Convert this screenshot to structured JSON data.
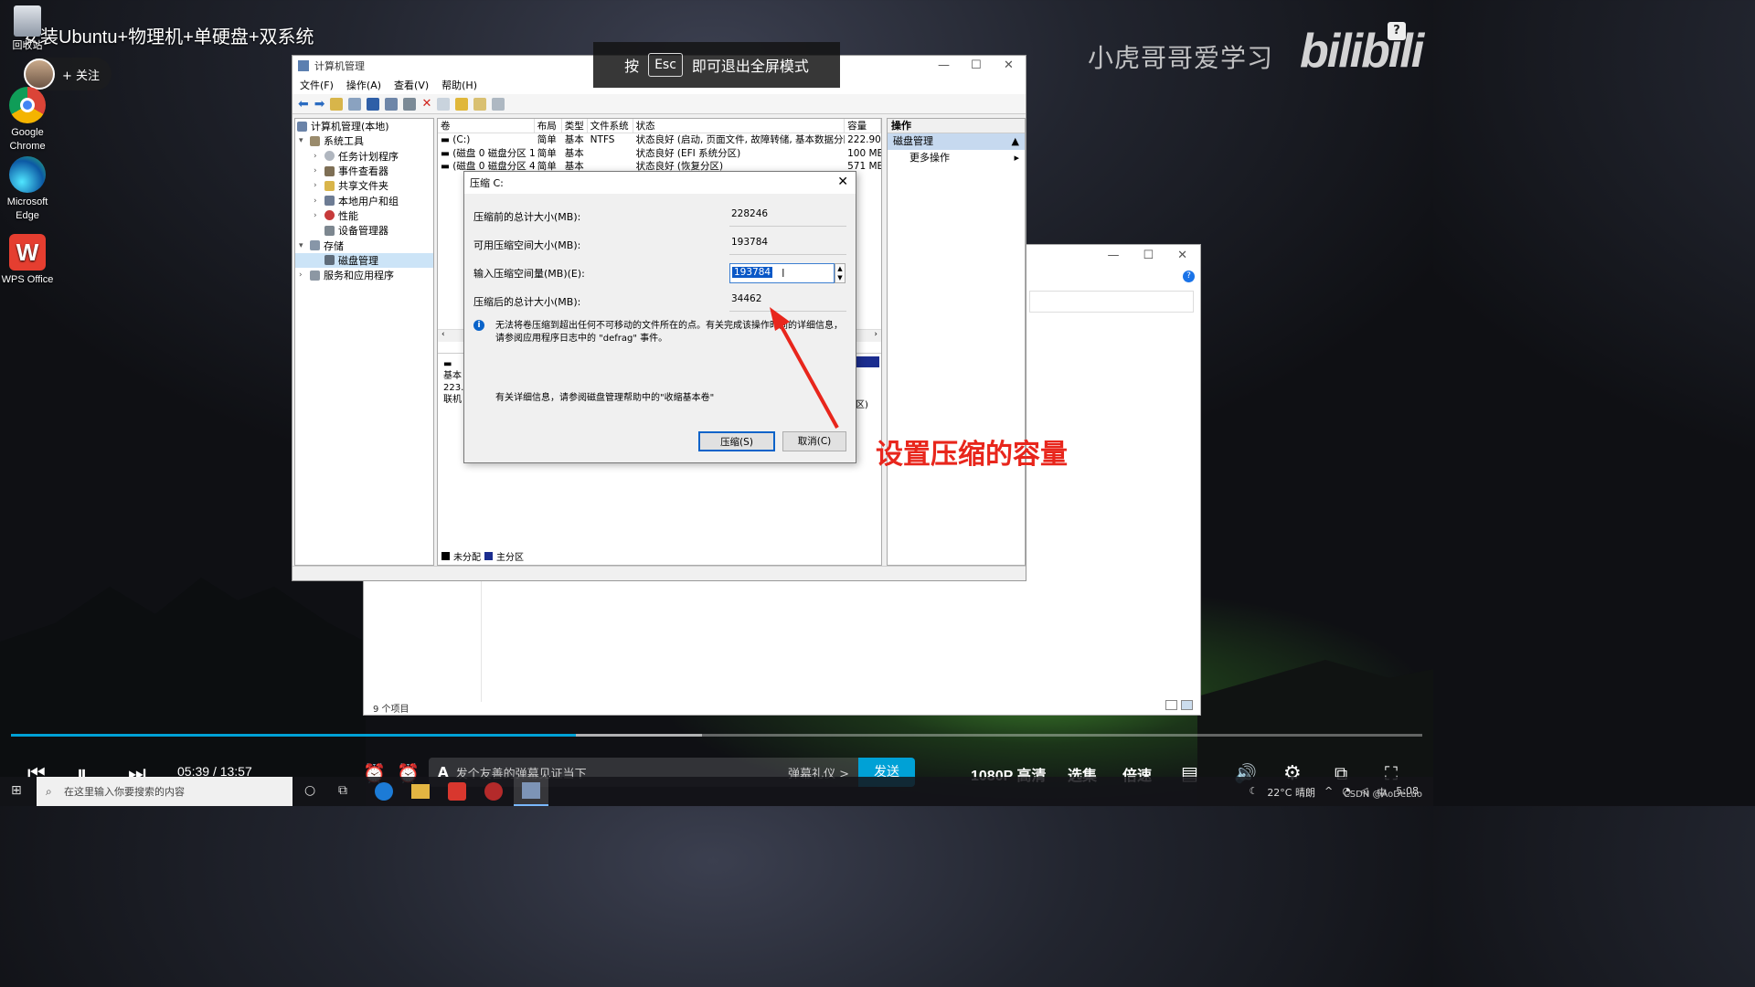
{
  "video": {
    "title": "安装Ubuntu+物理机+单硬盘+双系统",
    "follow_label": "+ 关注",
    "watermark": "小虎哥哥爱学习",
    "logo": "bilibili",
    "esc_prefix": "按",
    "esc_key": "Esc",
    "esc_suffix": "即可退出全屏模式",
    "annotation": "设置压缩的容量"
  },
  "desktop": {
    "icons": [
      {
        "label": "回收站",
        "icon": "recycle-bin-icon"
      },
      {
        "label": "Google Chrome",
        "icon": "chrome-icon"
      },
      {
        "label": "Microsoft Edge",
        "icon": "edge-icon"
      },
      {
        "label": "WPS Office",
        "icon": "wps-office-icon"
      }
    ]
  },
  "mmc": {
    "title": "计算机管理",
    "menus": [
      "文件(F)",
      "操作(A)",
      "查看(V)",
      "帮助(H)"
    ],
    "tree": [
      {
        "label": "计算机管理(本地)"
      },
      {
        "label": "系统工具"
      },
      {
        "label": "任务计划程序"
      },
      {
        "label": "事件查看器"
      },
      {
        "label": "共享文件夹"
      },
      {
        "label": "本地用户和组"
      },
      {
        "label": "性能"
      },
      {
        "label": "设备管理器"
      },
      {
        "label": "存储"
      },
      {
        "label": "磁盘管理"
      },
      {
        "label": "服务和应用程序"
      }
    ],
    "columns": [
      "卷",
      "布局",
      "类型",
      "文件系统",
      "状态",
      "容量"
    ],
    "volumes": [
      {
        "vol": "(C:)",
        "layout": "简单",
        "type": "基本",
        "fs": "NTFS",
        "status": "状态良好 (启动, 页面文件, 故障转储, 基本数据分区)",
        "cap": "222.90"
      },
      {
        "vol": "(磁盘 0 磁盘分区 1)",
        "layout": "简单",
        "type": "基本",
        "fs": "",
        "status": "状态良好 (EFI 系统分区)",
        "cap": "100 MB"
      },
      {
        "vol": "(磁盘 0 磁盘分区 4)",
        "layout": "简单",
        "type": "基本",
        "fs": "",
        "status": "状态良好 (恢复分区)",
        "cap": "571 MB"
      }
    ],
    "disk_info": [
      "基本",
      "223.",
      "联机"
    ],
    "disk_part_suffix": "区)",
    "legend": {
      "unallocated": "未分配",
      "primary": "主分区"
    },
    "actions": {
      "header": "操作",
      "section": "磁盘管理",
      "more": "更多操作"
    }
  },
  "dialog": {
    "title": "压缩 C:",
    "fields": [
      {
        "label": "压缩前的总计大小(MB):",
        "value": "228246"
      },
      {
        "label": "可用压缩空间大小(MB):",
        "value": "193784"
      },
      {
        "label": "输入压缩空间量(MB)(E):",
        "value": "193784"
      },
      {
        "label": "压缩后的总计大小(MB):",
        "value": "34462"
      }
    ],
    "info": "无法将卷压缩到超出任何不可移动的文件所在的点。有关完成该操作时间的详细信息，请参阅应用程序日志中的 \"defrag\" 事件。",
    "help": "有关详细信息，请参阅磁盘管理帮助中的\"收缩基本卷\"",
    "shrink_label": "压缩(S)",
    "cancel_label": "取消(C)"
  },
  "explorer": {
    "status": "9 个项目"
  },
  "player": {
    "current_time": "05:39",
    "separator": "/",
    "total_time": "13:57",
    "progress_fraction": 0.4,
    "danmaku_placeholder": "发个友善的弹幕见证当下",
    "danmaku_etiquette": "弹幕礼仪 >",
    "send_label": "发送",
    "quality": "1080P 高清",
    "episodes": "选集",
    "speed": "倍速",
    "accent": "#00a1d6"
  },
  "taskbar": {
    "search_placeholder": "在这里输入你要搜索的内容",
    "weather": "22°C 晴朗",
    "ime": "中",
    "clock": "5:08",
    "watermark": "CSDN @AoDeLuo"
  }
}
